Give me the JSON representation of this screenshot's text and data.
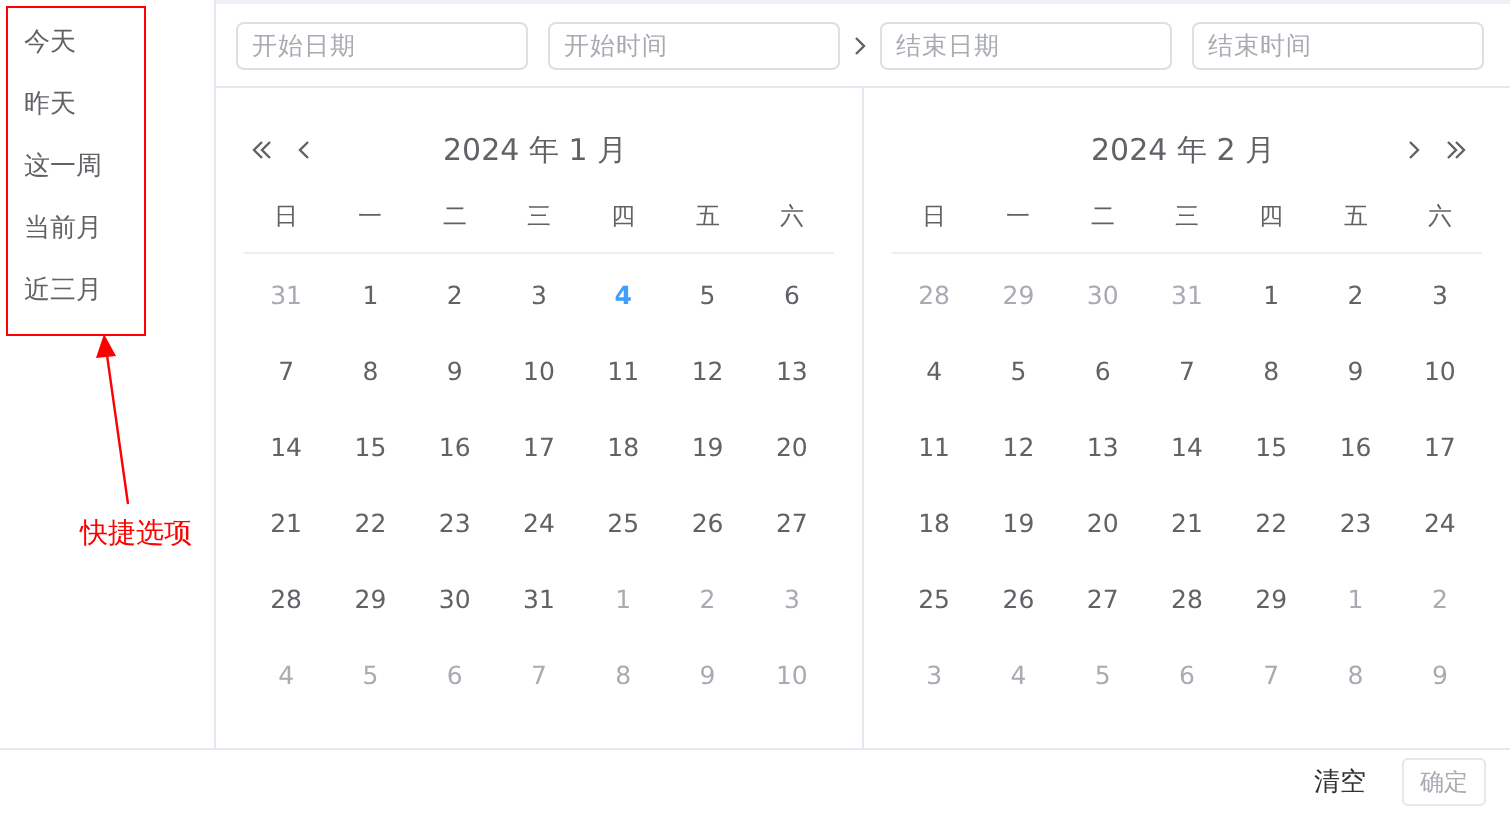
{
  "shortcuts": [
    {
      "label": "今天"
    },
    {
      "label": "昨天"
    },
    {
      "label": "这一周"
    },
    {
      "label": "当前月"
    },
    {
      "label": "近三月"
    }
  ],
  "annotation": {
    "label": "快捷选项"
  },
  "inputs": {
    "start_date": {
      "placeholder": "开始日期"
    },
    "start_time": {
      "placeholder": "开始时间"
    },
    "end_date": {
      "placeholder": "结束日期"
    },
    "end_time": {
      "placeholder": "结束时间"
    }
  },
  "calendars": [
    {
      "title": "2024 年 1 月",
      "nav_prev": true,
      "nav_next": false,
      "weekdays": [
        "日",
        "一",
        "二",
        "三",
        "四",
        "五",
        "六"
      ],
      "weeks": [
        [
          {
            "text": "31",
            "kind": "other"
          },
          {
            "text": "1",
            "kind": "current"
          },
          {
            "text": "2",
            "kind": "current"
          },
          {
            "text": "3",
            "kind": "current"
          },
          {
            "text": "4",
            "kind": "today"
          },
          {
            "text": "5",
            "kind": "current"
          },
          {
            "text": "6",
            "kind": "current"
          }
        ],
        [
          {
            "text": "7",
            "kind": "current"
          },
          {
            "text": "8",
            "kind": "current"
          },
          {
            "text": "9",
            "kind": "current"
          },
          {
            "text": "10",
            "kind": "current"
          },
          {
            "text": "11",
            "kind": "current"
          },
          {
            "text": "12",
            "kind": "current"
          },
          {
            "text": "13",
            "kind": "current"
          }
        ],
        [
          {
            "text": "14",
            "kind": "current"
          },
          {
            "text": "15",
            "kind": "current"
          },
          {
            "text": "16",
            "kind": "current"
          },
          {
            "text": "17",
            "kind": "current"
          },
          {
            "text": "18",
            "kind": "current"
          },
          {
            "text": "19",
            "kind": "current"
          },
          {
            "text": "20",
            "kind": "current"
          }
        ],
        [
          {
            "text": "21",
            "kind": "current"
          },
          {
            "text": "22",
            "kind": "current"
          },
          {
            "text": "23",
            "kind": "current"
          },
          {
            "text": "24",
            "kind": "current"
          },
          {
            "text": "25",
            "kind": "current"
          },
          {
            "text": "26",
            "kind": "current"
          },
          {
            "text": "27",
            "kind": "current"
          }
        ],
        [
          {
            "text": "28",
            "kind": "current"
          },
          {
            "text": "29",
            "kind": "current"
          },
          {
            "text": "30",
            "kind": "current"
          },
          {
            "text": "31",
            "kind": "current"
          },
          {
            "text": "1",
            "kind": "other"
          },
          {
            "text": "2",
            "kind": "other"
          },
          {
            "text": "3",
            "kind": "other"
          }
        ],
        [
          {
            "text": "4",
            "kind": "other"
          },
          {
            "text": "5",
            "kind": "other"
          },
          {
            "text": "6",
            "kind": "other"
          },
          {
            "text": "7",
            "kind": "other"
          },
          {
            "text": "8",
            "kind": "other"
          },
          {
            "text": "9",
            "kind": "other"
          },
          {
            "text": "10",
            "kind": "other"
          }
        ]
      ]
    },
    {
      "title": "2024 年 2 月",
      "nav_prev": false,
      "nav_next": true,
      "weekdays": [
        "日",
        "一",
        "二",
        "三",
        "四",
        "五",
        "六"
      ],
      "weeks": [
        [
          {
            "text": "28",
            "kind": "other"
          },
          {
            "text": "29",
            "kind": "other"
          },
          {
            "text": "30",
            "kind": "other"
          },
          {
            "text": "31",
            "kind": "other"
          },
          {
            "text": "1",
            "kind": "current"
          },
          {
            "text": "2",
            "kind": "current"
          },
          {
            "text": "3",
            "kind": "current"
          }
        ],
        [
          {
            "text": "4",
            "kind": "current"
          },
          {
            "text": "5",
            "kind": "current"
          },
          {
            "text": "6",
            "kind": "current"
          },
          {
            "text": "7",
            "kind": "current"
          },
          {
            "text": "8",
            "kind": "current"
          },
          {
            "text": "9",
            "kind": "current"
          },
          {
            "text": "10",
            "kind": "current"
          }
        ],
        [
          {
            "text": "11",
            "kind": "current"
          },
          {
            "text": "12",
            "kind": "current"
          },
          {
            "text": "13",
            "kind": "current"
          },
          {
            "text": "14",
            "kind": "current"
          },
          {
            "text": "15",
            "kind": "current"
          },
          {
            "text": "16",
            "kind": "current"
          },
          {
            "text": "17",
            "kind": "current"
          }
        ],
        [
          {
            "text": "18",
            "kind": "current"
          },
          {
            "text": "19",
            "kind": "current"
          },
          {
            "text": "20",
            "kind": "current"
          },
          {
            "text": "21",
            "kind": "current"
          },
          {
            "text": "22",
            "kind": "current"
          },
          {
            "text": "23",
            "kind": "current"
          },
          {
            "text": "24",
            "kind": "current"
          }
        ],
        [
          {
            "text": "25",
            "kind": "current"
          },
          {
            "text": "26",
            "kind": "current"
          },
          {
            "text": "27",
            "kind": "current"
          },
          {
            "text": "28",
            "kind": "current"
          },
          {
            "text": "29",
            "kind": "current"
          },
          {
            "text": "1",
            "kind": "other"
          },
          {
            "text": "2",
            "kind": "other"
          }
        ],
        [
          {
            "text": "3",
            "kind": "other"
          },
          {
            "text": "4",
            "kind": "other"
          },
          {
            "text": "5",
            "kind": "other"
          },
          {
            "text": "6",
            "kind": "other"
          },
          {
            "text": "7",
            "kind": "other"
          },
          {
            "text": "8",
            "kind": "other"
          },
          {
            "text": "9",
            "kind": "other"
          }
        ]
      ]
    }
  ],
  "footer": {
    "clear": "清空",
    "confirm": {
      "label": "确定",
      "disabled": true
    }
  }
}
